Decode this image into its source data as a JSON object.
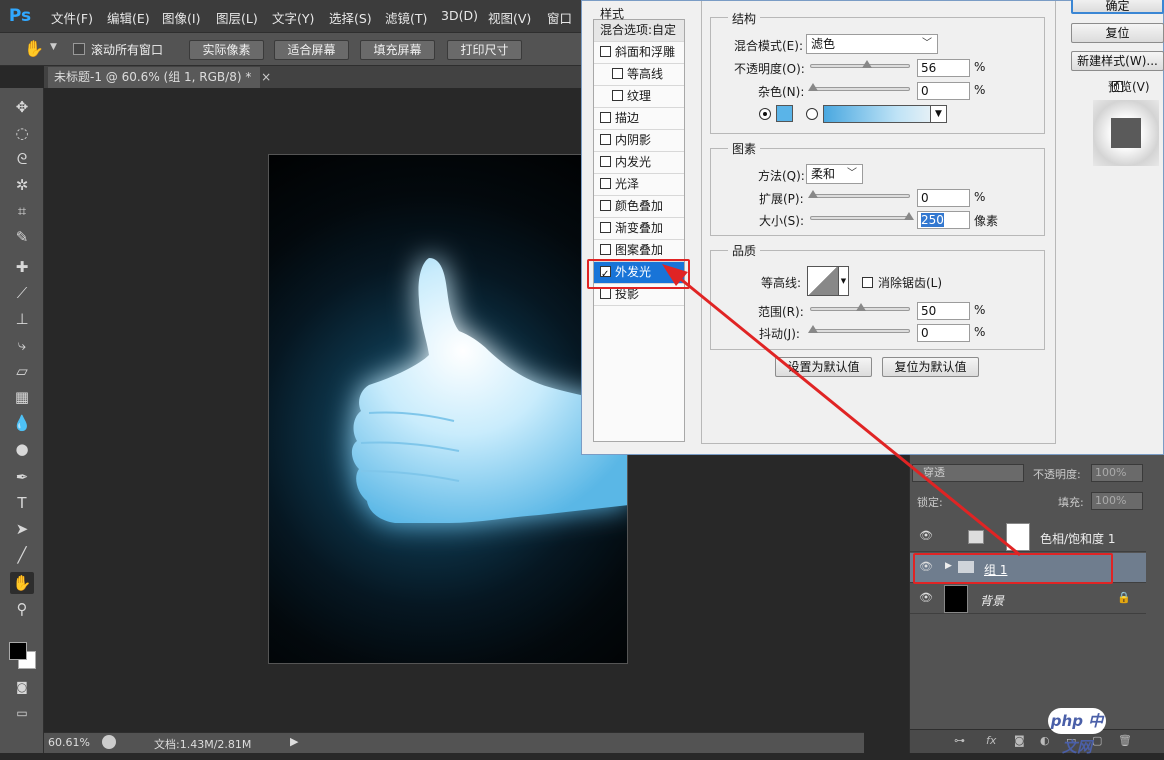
{
  "app": {
    "logo": "Ps",
    "menu": [
      "文件(F)",
      "编辑(E)",
      "图像(I)",
      "图层(L)",
      "文字(Y)",
      "选择(S)",
      "滤镜(T)",
      "3D(D)",
      "视图(V)",
      "窗口"
    ]
  },
  "options_bar": {
    "scroll_all": "滚动所有窗口",
    "buttons": [
      "实际像素",
      "适合屏幕",
      "填充屏幕",
      "打印尺寸"
    ]
  },
  "document_tab": "未标题-1 @ 60.6% (组 1, RGB/8) *",
  "status_bar": {
    "zoom": "60.61%",
    "doc_info": "文档:1.43M/2.81M"
  },
  "dialog": {
    "styles_header": "样式",
    "blend_options": "混合选项:自定",
    "style_items": [
      {
        "label": "斜面和浮雕",
        "checked": false
      },
      {
        "label": "等高线",
        "checked": false
      },
      {
        "label": "纹理",
        "checked": false
      },
      {
        "label": "描边",
        "checked": false
      },
      {
        "label": "内阴影",
        "checked": false
      },
      {
        "label": "内发光",
        "checked": false
      },
      {
        "label": "光泽",
        "checked": false
      },
      {
        "label": "颜色叠加",
        "checked": false
      },
      {
        "label": "渐变叠加",
        "checked": false
      },
      {
        "label": "图案叠加",
        "checked": false
      },
      {
        "label": "外发光",
        "checked": true
      },
      {
        "label": "投影",
        "checked": false
      }
    ],
    "structure": {
      "title": "结构",
      "blend_mode_label": "混合模式(E):",
      "blend_mode_value": "滤色",
      "opacity_label": "不透明度(O):",
      "opacity_value": "56",
      "noise_label": "杂色(N):",
      "noise_value": "0",
      "unit_percent": "%",
      "swatch_color": "#5ab4e8"
    },
    "elements": {
      "title": "图素",
      "method_label": "方法(Q):",
      "method_value": "柔和",
      "spread_label": "扩展(P):",
      "spread_value": "0",
      "size_label": "大小(S):",
      "size_value": "250",
      "size_unit": "像素"
    },
    "quality": {
      "title": "品质",
      "contour_label": "等高线:",
      "antialias_label": "消除锯齿(L)",
      "range_label": "范围(R):",
      "range_value": "50",
      "jitter_label": "抖动(J):",
      "jitter_value": "0"
    },
    "set_default": "设置为默认值",
    "reset_default": "复位为默认值",
    "ok": "确定",
    "reset": "复位",
    "new_style": "新建样式(W)...",
    "preview": "预览(V)"
  },
  "layers_panel": {
    "blend_mode": "穿透",
    "opacity_label": "不透明度:",
    "opacity_value": "100%",
    "lock_label": "锁定:",
    "fill_label": "填充:",
    "fill_value": "100%",
    "layers": [
      {
        "name": "色相/饱和度 1"
      },
      {
        "name": "组 1"
      },
      {
        "name": "背景"
      }
    ]
  },
  "watermark": "php 中文网",
  "colors": {
    "selection_blue": "#1874d8",
    "annotation_red": "#e02424"
  }
}
